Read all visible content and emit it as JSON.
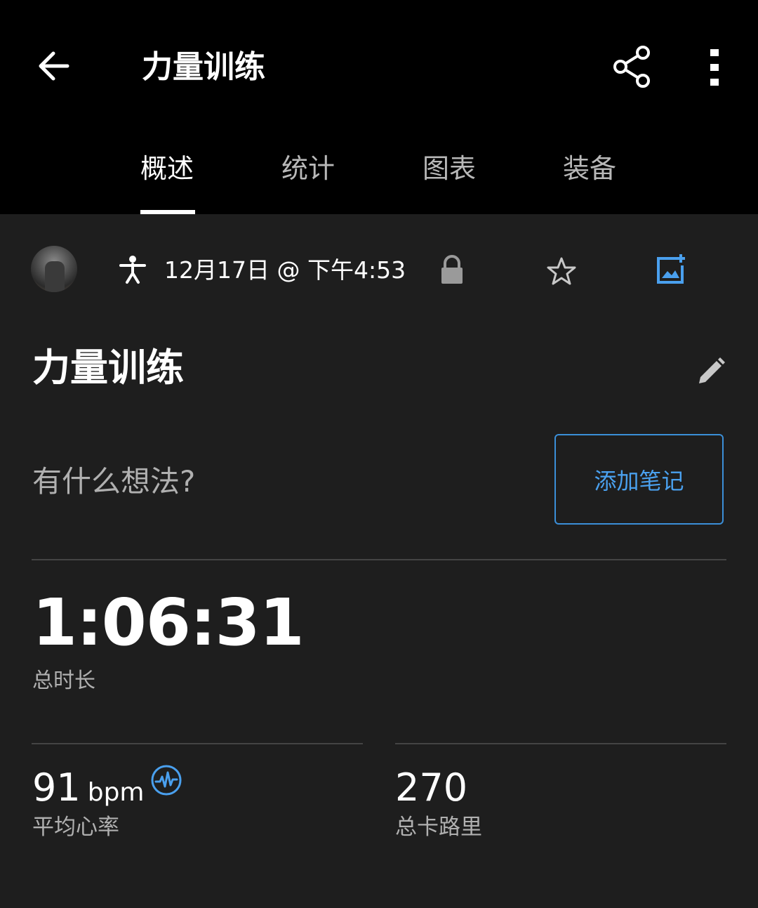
{
  "header": {
    "title": "力量训练",
    "back_icon": "arrow-left-icon",
    "share_icon": "share-icon",
    "more_icon": "more-vertical-icon"
  },
  "tabs": [
    {
      "label": "概述",
      "active": true
    },
    {
      "label": "统计",
      "active": false
    },
    {
      "label": "图表",
      "active": false
    },
    {
      "label": "装备",
      "active": false
    }
  ],
  "activity": {
    "datetime": "12月17日 @ 下午4:53",
    "activity_icon": "strength-training-icon",
    "privacy_icon": "lock-icon",
    "favorite_icon": "star-outline-icon",
    "photo_icon": "add-photo-icon"
  },
  "workout": {
    "title": "力量训练",
    "edit_icon": "pencil-icon"
  },
  "notes": {
    "prompt": "有什么想法?",
    "add_button": "添加笔记"
  },
  "stats": {
    "duration": {
      "value": "1:06:31",
      "label": "总时长"
    },
    "avg_heart_rate": {
      "value": "91",
      "unit": "bpm",
      "label": "平均心率",
      "icon": "heart-rate-icon"
    },
    "calories": {
      "value": "270",
      "label": "总卡路里"
    }
  },
  "colors": {
    "background": "#1e1e1e",
    "header_background": "#000000",
    "accent": "#3b8fd8",
    "secondary_text": "#b0b0b0",
    "divider": "#444444"
  }
}
